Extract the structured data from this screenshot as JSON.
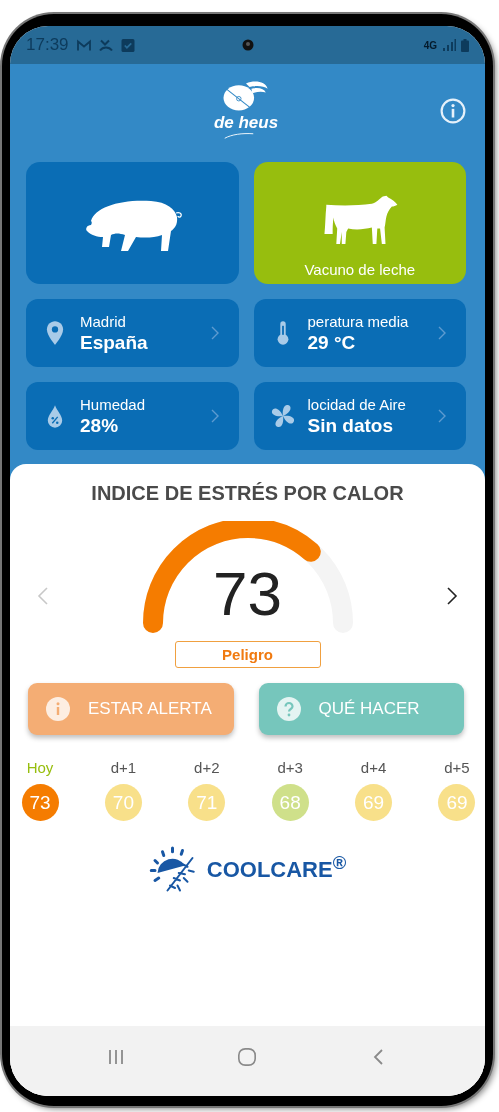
{
  "status_bar": {
    "time": "17:39",
    "network": "4G"
  },
  "logo": {
    "text": "de heus"
  },
  "animals": [
    {
      "kind": "pig",
      "selected": false
    },
    {
      "kind": "cow",
      "label": "Vacuno de leche",
      "selected": true
    }
  ],
  "conditions": [
    {
      "kind": "location",
      "label": "Madrid",
      "value": "España"
    },
    {
      "kind": "temperature",
      "label": "peratura media",
      "value": "29 °C"
    },
    {
      "kind": "humidity",
      "label": "Humedad",
      "value": "28%"
    },
    {
      "kind": "wind",
      "label": "locidad de Aire",
      "value": "Sin datos"
    }
  ],
  "heat_index": {
    "title": "INDICE DE ESTRÉS POR CALOR",
    "value": "73",
    "status": "Peligro",
    "prev_disabled": true,
    "next_disabled": false
  },
  "actions": [
    {
      "kind": "alert",
      "label": "ESTAR ALERTA",
      "color": "#f4ad74"
    },
    {
      "kind": "help",
      "label": "QUÉ HACER",
      "color": "#76c6bc"
    }
  ],
  "forecast": [
    {
      "day": "Hoy",
      "value": "73",
      "color": "#f57c00",
      "selected": true
    },
    {
      "day": "d+1",
      "value": "70",
      "color": "#f8e08a",
      "selected": false
    },
    {
      "day": "d+2",
      "value": "71",
      "color": "#f8e08a",
      "selected": false
    },
    {
      "day": "d+3",
      "value": "68",
      "color": "#cfe08a",
      "selected": false
    },
    {
      "day": "d+4",
      "value": "69",
      "color": "#f8e08a",
      "selected": false
    },
    {
      "day": "d+5",
      "value": "69",
      "color": "#f8e08a",
      "selected": false
    }
  ],
  "brand": {
    "text": "COOLCARE$^{®}$"
  }
}
